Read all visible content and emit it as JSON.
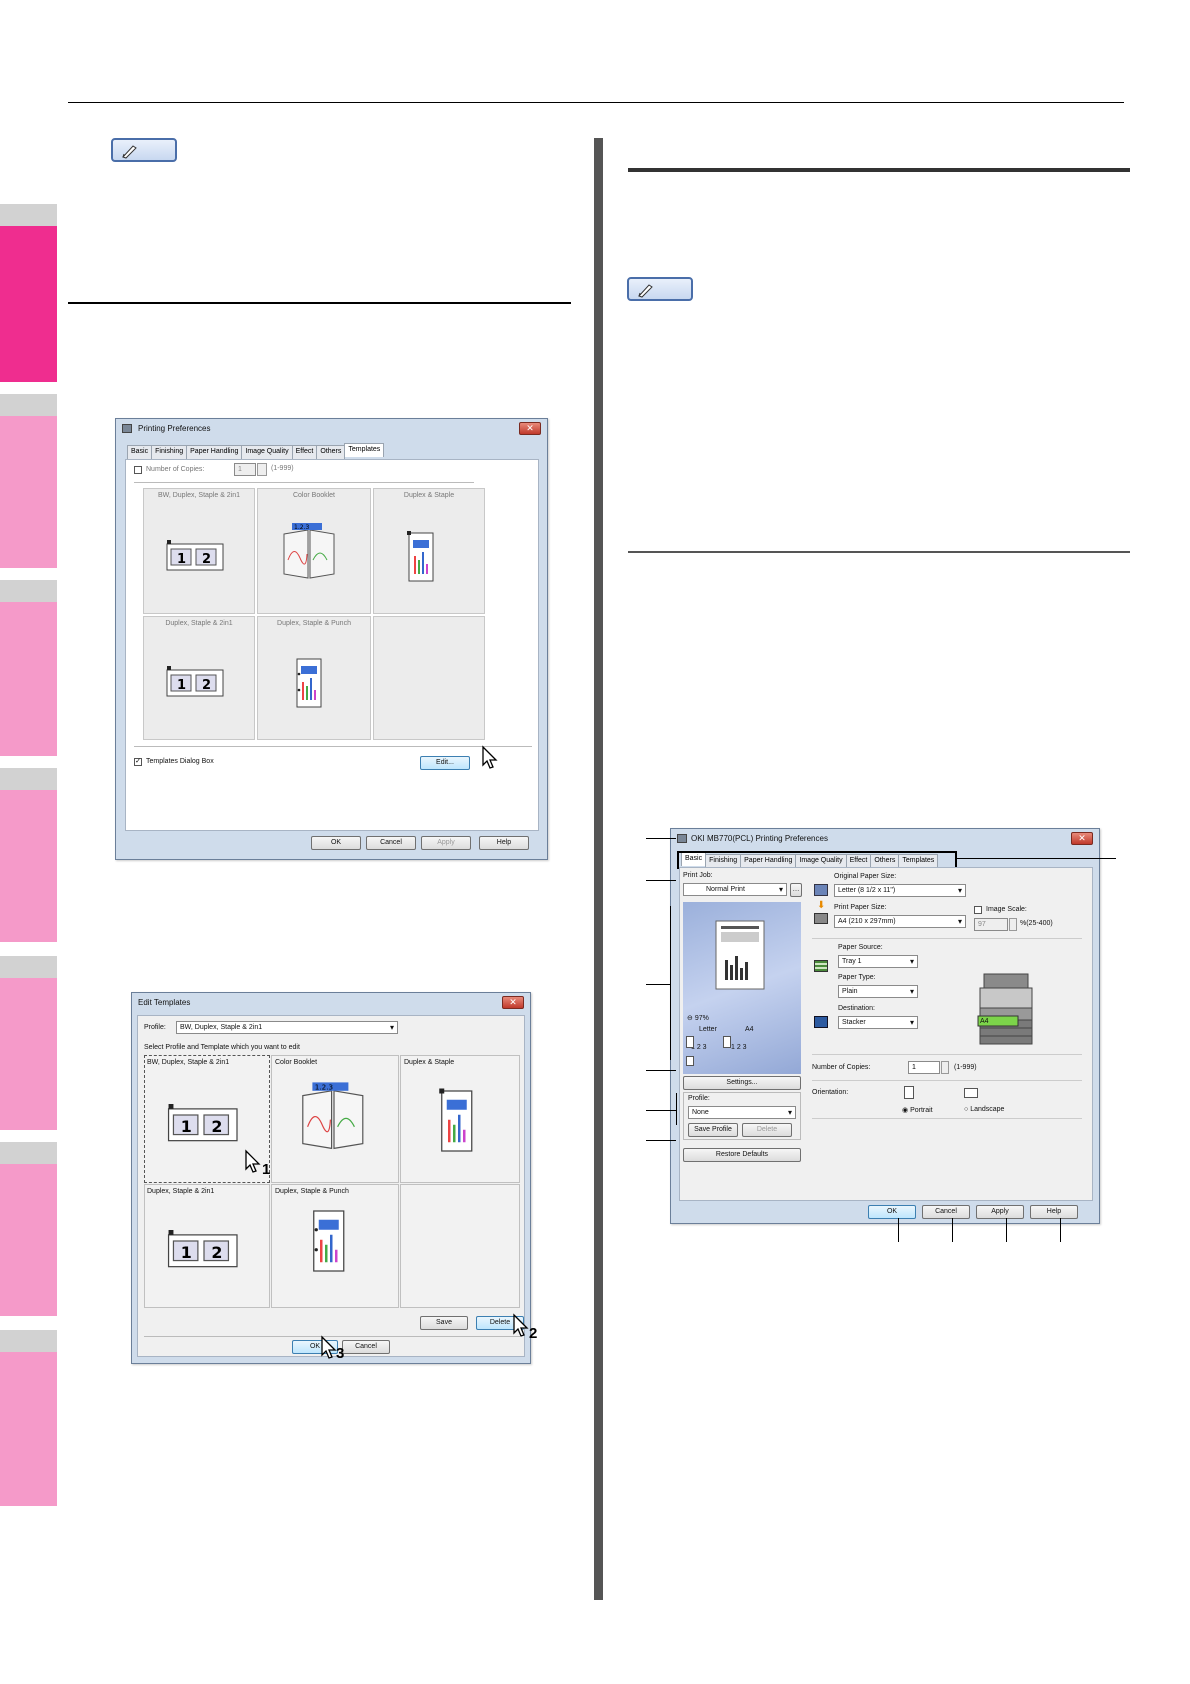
{
  "colors": {
    "tab_active": "#ef2d8f",
    "tab_light": "#f59ac9",
    "tab_grey": "#d2d2d2",
    "divider": "#555555"
  },
  "templates_dialog": {
    "title": "Printing Preferences",
    "tabs": [
      "Basic",
      "Finishing",
      "Paper Handling",
      "Image Quality",
      "Effect",
      "Others",
      "Templates"
    ],
    "active_tab": "Templates",
    "number_of_copies_label": "Number of Copies:",
    "copies_value": "1",
    "copies_range": "(1-999)",
    "cells": [
      "BW, Duplex, Staple & 2in1",
      "Color Booklet",
      "Duplex & Staple",
      "Duplex, Staple & 2in1",
      "Duplex, Staple & Punch"
    ],
    "templates_dialog_box_label": "Templates Dialog Box",
    "edit_button": "Edit...",
    "buttons": {
      "ok": "OK",
      "cancel": "Cancel",
      "apply": "Apply",
      "help": "Help"
    }
  },
  "edit_templates": {
    "title": "Edit Templates",
    "profile_label": "Profile:",
    "profile_value": "BW, Duplex, Staple & 2in1",
    "instruction": "Select Profile and Template which you want to edit",
    "cells": [
      "BW, Duplex, Staple & 2in1",
      "Color Booklet",
      "Duplex & Staple",
      "Duplex, Staple & 2in1",
      "Duplex, Staple & Punch"
    ],
    "save_button": "Save",
    "delete_button": "Delete",
    "ok_button": "OK",
    "cancel_button": "Cancel",
    "steps": [
      "1",
      "2",
      "3"
    ]
  },
  "basic_dialog": {
    "title": "OKI MB770(PCL) Printing Preferences",
    "tabs": [
      "Basic",
      "Finishing",
      "Paper Handling",
      "Image Quality",
      "Effect",
      "Others",
      "Templates"
    ],
    "active_tab": "Basic",
    "print_job_label": "Print Job:",
    "print_job_value": "Normal Print",
    "preview_zoom": "97%",
    "preview_from": "Letter",
    "preview_to": "A4",
    "preview_pages": "1 2 3",
    "settings_button": "Settings...",
    "profile_label": "Profile:",
    "profile_value": "None",
    "save_profile_button": "Save Profile",
    "delete_button": "Delete",
    "restore_defaults_button": "Restore Defaults",
    "original_paper_size_label": "Original Paper Size:",
    "original_paper_size_value": "Letter (8 1/2 x 11\")",
    "print_paper_size_label": "Print Paper Size:",
    "print_paper_size_value": "A4 (210 x 297mm)",
    "image_scale_label": "Image Scale:",
    "image_scale_value": "97",
    "image_scale_range": "%(25-400)",
    "paper_source_label": "Paper Source:",
    "paper_source_value": "Tray 1",
    "paper_type_label": "Paper Type:",
    "paper_type_value": "Plain",
    "destination_label": "Destination:",
    "destination_value": "Stacker",
    "printer_tray_label": "A4",
    "copies_label": "Number of Copies:",
    "copies_value": "1",
    "copies_range": "(1-999)",
    "orientation_label": "Orientation:",
    "portrait_label": "Portrait",
    "landscape_label": "Landscape",
    "buttons": {
      "ok": "OK",
      "cancel": "Cancel",
      "apply": "Apply",
      "help": "Help"
    }
  }
}
